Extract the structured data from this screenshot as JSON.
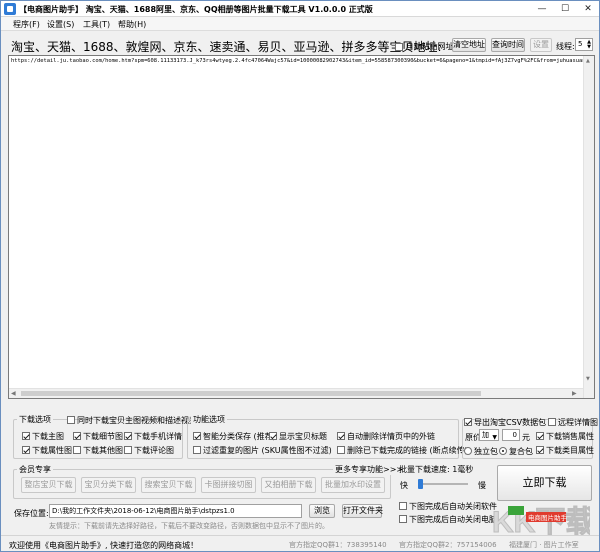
{
  "window": {
    "title": "【电商图片助手】 淘宝、天猫、1688阿里、京东、QQ相册等图片批量下载工具 V1.0.0.0 正式版",
    "minimize": "—",
    "maximize": "☐",
    "close": "✕"
  },
  "menu": [
    "程序(F)",
    "设置(S)",
    "工具(T)",
    "帮助(H)"
  ],
  "url_row": {
    "label": "淘宝、天猫、1688、敦煌网、京东、速卖通、易贝、亚马逊、拼多多等宝贝地址:",
    "auto_paste": "自动粘贴网址",
    "clear": "清空地址",
    "query": "查询时间",
    "settings": "设置",
    "threads_label": "线程:",
    "threads_value": "5"
  },
  "textarea": {
    "content": "https://detail.ju.taobao.com/home.htm?spm=608.11133173.J_k73rs4wtyeg.2.4fc47064Wajc57&id=10000082902743&item_id=558587300390&bucket=6&pageno=1&tmpid=fAj3Z7vgF%2FC&from=juhuasuan"
  },
  "download_options": {
    "title": "下载选项",
    "sync_video": "同时下载宝贝主图视频和描述视频",
    "main_image": "下载主图",
    "detail_image": "下载细节图",
    "mobile_detail": "下载手机详情",
    "attr_image": "下载属性图",
    "other_image": "下载其他图",
    "review_image": "下载评论图"
  },
  "function_options": {
    "title": "功能选项",
    "smart_save": "智能分类保存 (推荐)",
    "show_title": "显示宝贝标题",
    "auto_delete": "自动删除详情页中的外链",
    "filter_repeat": "过滤重复的图片 (SKU属性图不过滤)",
    "delete_done": "删除已下载完成的链接 (断点续传)"
  },
  "right_options": {
    "export_csv": "导出淘宝CSV数据包",
    "remote_detail": "远程详情图",
    "price_label": "原价",
    "price_op": "加",
    "price_value": "0",
    "price_unit": "元",
    "sales_attr": "下载销售属性",
    "standalone": "独立包",
    "combined": "复合包",
    "shop_attr": "下载类目属性"
  },
  "member": {
    "title": "会员专享",
    "more": "更多专享功能>>>",
    "buttons": [
      "整店宝贝下载",
      "宝贝分类下载",
      "搜索宝贝下载",
      "卡图拼接切图",
      "又拍相册下载",
      "批量加水印设置"
    ]
  },
  "speed": {
    "label": "批量下载速度: 1毫秒",
    "fast": "快",
    "slow": "慢",
    "start": "立即下载",
    "auto_close_app": "下图完成后自动关闭软件",
    "auto_shutdown": "下图完成后自动关闭电脑"
  },
  "save": {
    "label": "保存位置:",
    "path": "D:\\我的工作文件夹\\2018-06-12\\电商图片助手\\dstpzs1.0",
    "browse": "浏览",
    "open_folder": "打开文件夹",
    "tip": "友情提示：下载前请先选择好路径，下载后不要改变路径，否则数据包中显示不了图片的。"
  },
  "status": {
    "welcome": "欢迎使用《电商图片助手》, 快速打造您的网络商城！",
    "qq1": "官方指定QQ群1：738395140",
    "qq2": "官方指定QQ群2：757154006",
    "vendor": "福建厦门 · 图片工作室"
  },
  "watermark": {
    "text": "KK下载",
    "sub": "电商图片助手"
  },
  "colors": {
    "accent": "#2f7bd6",
    "watermark_red": "#e03a2e",
    "watermark_green": "#3aa43a"
  }
}
